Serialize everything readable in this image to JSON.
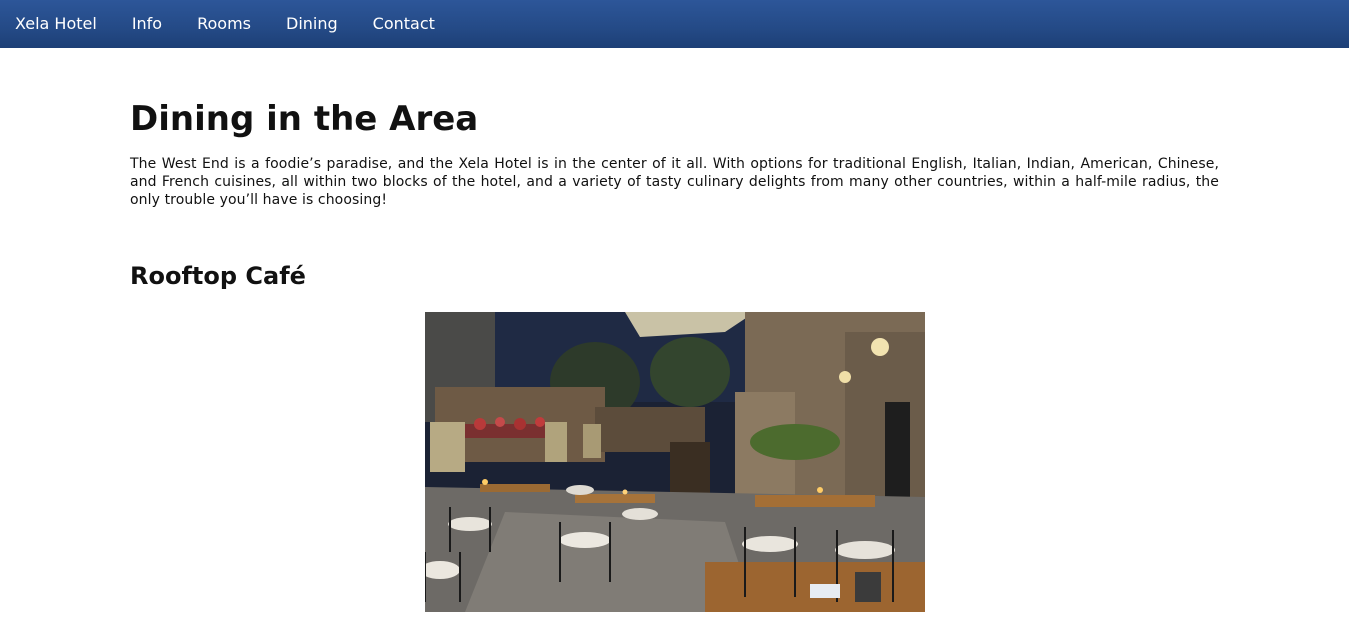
{
  "nav": {
    "brand": "Xela Hotel",
    "items": [
      {
        "label": "Info"
      },
      {
        "label": "Rooms"
      },
      {
        "label": "Dining"
      },
      {
        "label": "Contact"
      }
    ]
  },
  "main": {
    "title": "Dining in the Area",
    "intro": "The West End is a foodie’s paradise, and the Xela Hotel is in the center of it all. With options for traditional English, Italian, Indian, American, Chinese, and French cuisines, all within two blocks of the hotel, and a variety of tasty culinary delights from many other countries, within a half-mile radius, the only trouble you’ll have is choosing!",
    "sections": [
      {
        "title": "Rooftop Café"
      }
    ]
  },
  "colors": {
    "nav_background": "#244a86",
    "nav_text": "#ffffff",
    "body_background": "#ffffff"
  }
}
